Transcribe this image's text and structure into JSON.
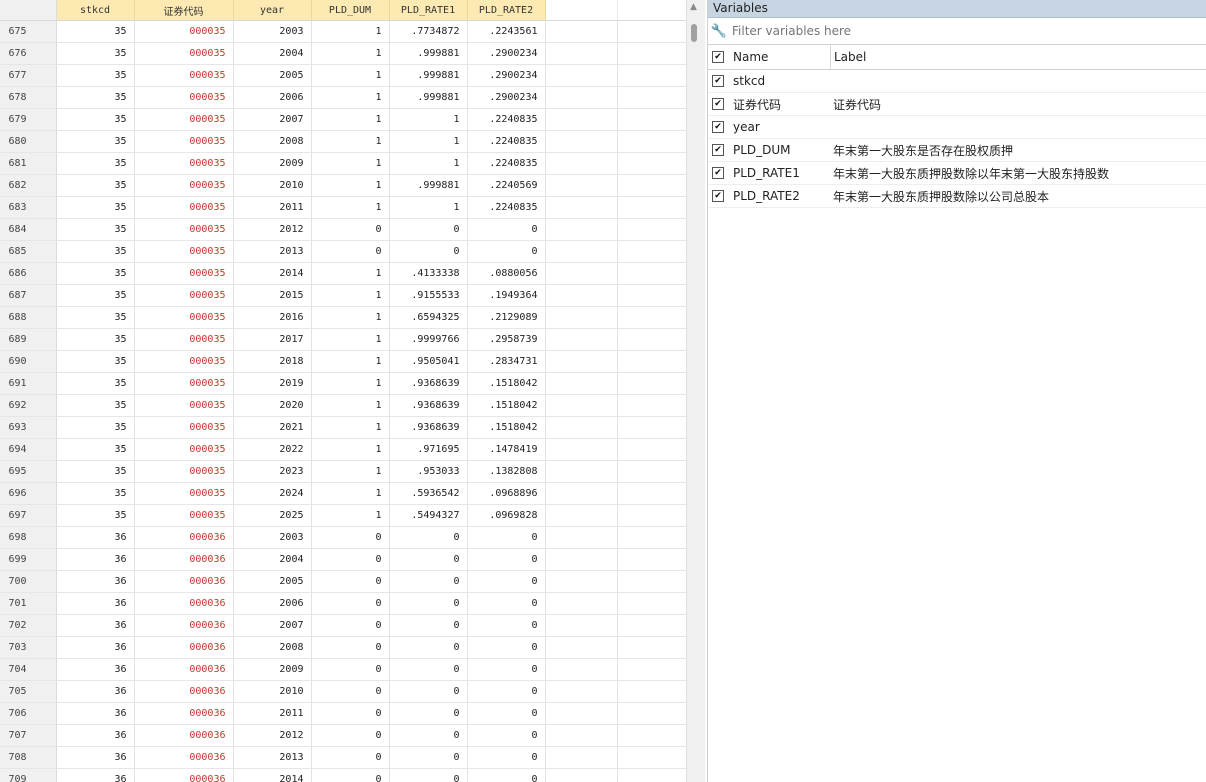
{
  "grid": {
    "columns": [
      "stkcd",
      "证券代码",
      "year",
      "PLD_DUM",
      "PLD_RATE1",
      "PLD_RATE2"
    ],
    "rows": [
      [
        "675",
        "35",
        "000035",
        "2003",
        "1",
        ".7734872",
        ".2243561"
      ],
      [
        "676",
        "35",
        "000035",
        "2004",
        "1",
        ".999881",
        ".2900234"
      ],
      [
        "677",
        "35",
        "000035",
        "2005",
        "1",
        ".999881",
        ".2900234"
      ],
      [
        "678",
        "35",
        "000035",
        "2006",
        "1",
        ".999881",
        ".2900234"
      ],
      [
        "679",
        "35",
        "000035",
        "2007",
        "1",
        "1",
        ".2240835"
      ],
      [
        "680",
        "35",
        "000035",
        "2008",
        "1",
        "1",
        ".2240835"
      ],
      [
        "681",
        "35",
        "000035",
        "2009",
        "1",
        "1",
        ".2240835"
      ],
      [
        "682",
        "35",
        "000035",
        "2010",
        "1",
        ".999881",
        ".2240569"
      ],
      [
        "683",
        "35",
        "000035",
        "2011",
        "1",
        "1",
        ".2240835"
      ],
      [
        "684",
        "35",
        "000035",
        "2012",
        "0",
        "0",
        "0"
      ],
      [
        "685",
        "35",
        "000035",
        "2013",
        "0",
        "0",
        "0"
      ],
      [
        "686",
        "35",
        "000035",
        "2014",
        "1",
        ".4133338",
        ".0880056"
      ],
      [
        "687",
        "35",
        "000035",
        "2015",
        "1",
        ".9155533",
        ".1949364"
      ],
      [
        "688",
        "35",
        "000035",
        "2016",
        "1",
        ".6594325",
        ".2129089"
      ],
      [
        "689",
        "35",
        "000035",
        "2017",
        "1",
        ".9999766",
        ".2958739"
      ],
      [
        "690",
        "35",
        "000035",
        "2018",
        "1",
        ".9505041",
        ".2834731"
      ],
      [
        "691",
        "35",
        "000035",
        "2019",
        "1",
        ".9368639",
        ".1518042"
      ],
      [
        "692",
        "35",
        "000035",
        "2020",
        "1",
        ".9368639",
        ".1518042"
      ],
      [
        "693",
        "35",
        "000035",
        "2021",
        "1",
        ".9368639",
        ".1518042"
      ],
      [
        "694",
        "35",
        "000035",
        "2022",
        "1",
        ".971695",
        ".1478419"
      ],
      [
        "695",
        "35",
        "000035",
        "2023",
        "1",
        ".953033",
        ".1382808"
      ],
      [
        "696",
        "35",
        "000035",
        "2024",
        "1",
        ".5936542",
        ".0968896"
      ],
      [
        "697",
        "35",
        "000035",
        "2025",
        "1",
        ".5494327",
        ".0969828"
      ],
      [
        "698",
        "36",
        "000036",
        "2003",
        "0",
        "0",
        "0"
      ],
      [
        "699",
        "36",
        "000036",
        "2004",
        "0",
        "0",
        "0"
      ],
      [
        "700",
        "36",
        "000036",
        "2005",
        "0",
        "0",
        "0"
      ],
      [
        "701",
        "36",
        "000036",
        "2006",
        "0",
        "0",
        "0"
      ],
      [
        "702",
        "36",
        "000036",
        "2007",
        "0",
        "0",
        "0"
      ],
      [
        "703",
        "36",
        "000036",
        "2008",
        "0",
        "0",
        "0"
      ],
      [
        "704",
        "36",
        "000036",
        "2009",
        "0",
        "0",
        "0"
      ],
      [
        "705",
        "36",
        "000036",
        "2010",
        "0",
        "0",
        "0"
      ],
      [
        "706",
        "36",
        "000036",
        "2011",
        "0",
        "0",
        "0"
      ],
      [
        "707",
        "36",
        "000036",
        "2012",
        "0",
        "0",
        "0"
      ],
      [
        "708",
        "36",
        "000036",
        "2013",
        "0",
        "0",
        "0"
      ],
      [
        "709",
        "36",
        "000036",
        "2014",
        "0",
        "0",
        "0"
      ]
    ]
  },
  "variables": {
    "title": "Variables",
    "filter_placeholder": "Filter variables here",
    "name_header": "Name",
    "label_header": "Label",
    "items": [
      {
        "name": "stkcd",
        "label": ""
      },
      {
        "name": "证券代码",
        "label": "证券代码"
      },
      {
        "name": "year",
        "label": ""
      },
      {
        "name": "PLD_DUM",
        "label": "年末第一大股东是否存在股权质押"
      },
      {
        "name": "PLD_RATE1",
        "label": "年末第一大股东质押股数除以年末第一大股东持股数"
      },
      {
        "name": "PLD_RATE2",
        "label": "年末第一大股东质押股数除以公司总股本"
      }
    ]
  },
  "icons": {
    "wrench": "wrench-icon",
    "checkbox": "checkbox-checked-icon",
    "scroll_up": "scroll-up-arrow-icon"
  },
  "colors": {
    "header_bg": "#fdeab2",
    "code_text": "#c0392b",
    "panel_title_bg": "#c7d5e2"
  }
}
